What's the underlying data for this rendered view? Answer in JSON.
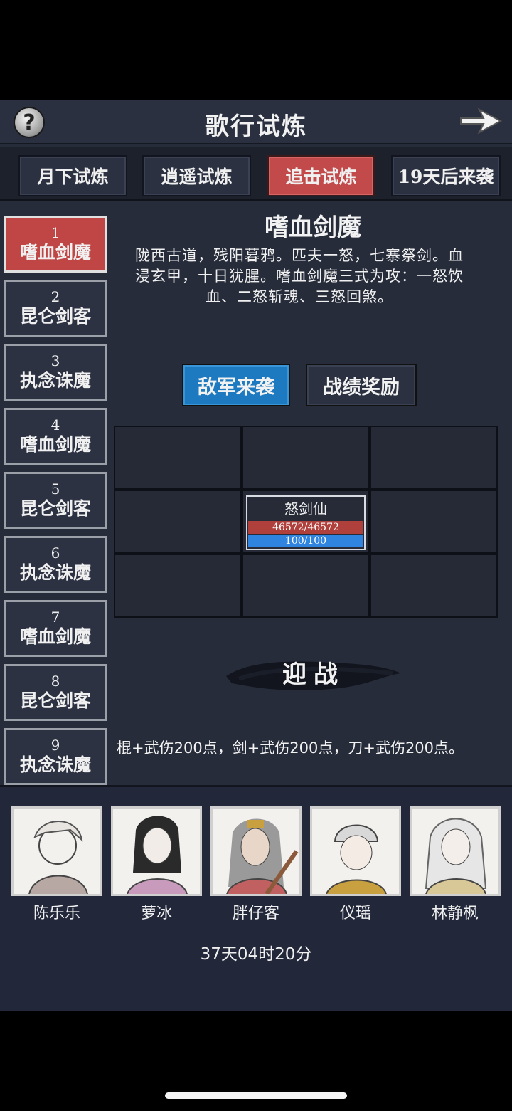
{
  "header": {
    "title": "歌行试炼",
    "help_icon": "question-icon",
    "next_icon": "arrow-right-icon"
  },
  "tabs": [
    {
      "label": "月下试炼",
      "active": false
    },
    {
      "label": "逍遥试炼",
      "active": false
    },
    {
      "label": "追击试炼",
      "active": true
    },
    {
      "label": "19天后来袭",
      "active": false
    }
  ],
  "stages": [
    {
      "num": "1",
      "name": "嗜血剑魔",
      "active": true
    },
    {
      "num": "2",
      "name": "昆仑剑客",
      "active": false
    },
    {
      "num": "3",
      "name": "执念诛魔",
      "active": false
    },
    {
      "num": "4",
      "name": "嗜血剑魔",
      "active": false
    },
    {
      "num": "5",
      "name": "昆仑剑客",
      "active": false
    },
    {
      "num": "6",
      "name": "执念诛魔",
      "active": false
    },
    {
      "num": "7",
      "name": "嗜血剑魔",
      "active": false
    },
    {
      "num": "8",
      "name": "昆仑剑客",
      "active": false
    },
    {
      "num": "9",
      "name": "执念诛魔",
      "active": false
    }
  ],
  "boss": {
    "name": "嗜血剑魔",
    "description": "陇西古道，残阳暮鸦。匹夫一怒，七寨祭剑。血浸玄甲，十日犹腥。嗜血剑魔三式为攻：一怒饮血、二怒斩魂、三怒回煞。"
  },
  "actions": {
    "enemy_label": "敌军来袭",
    "reward_label": "战绩奖励"
  },
  "enemy": {
    "name": "怒剑仙",
    "hp_text": "46572/46572",
    "mp_text": "100/100",
    "hp_fraction": 1.0,
    "mp_fraction": 1.0
  },
  "battle_label": "迎战",
  "bonus_text": "棍+武伤200点，剑+武伤200点，刀+武伤200点。",
  "party": [
    {
      "name": "陈乐乐"
    },
    {
      "name": "萝冰"
    },
    {
      "name": "胖仔客"
    },
    {
      "name": "仪瑶"
    },
    {
      "name": "林静枫"
    }
  ],
  "time_text": "37天04时20分"
}
